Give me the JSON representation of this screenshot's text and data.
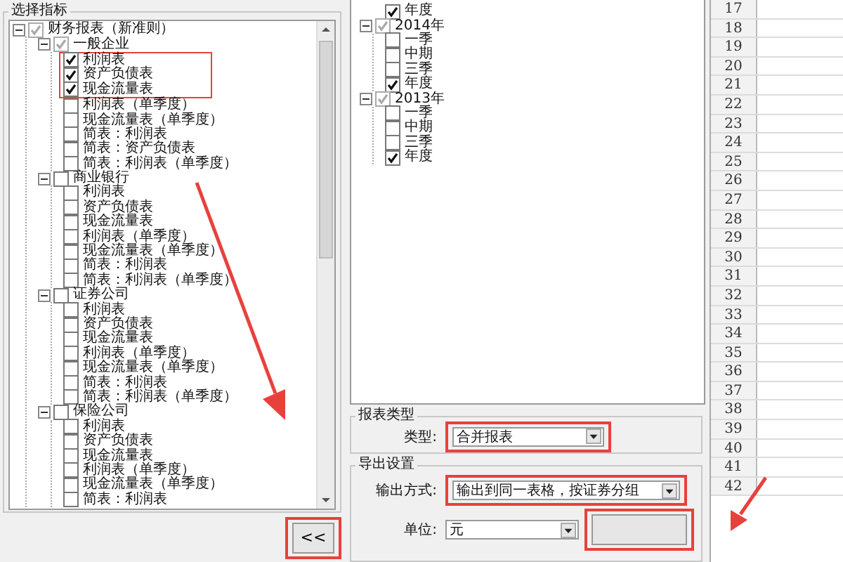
{
  "indicator_panel": {
    "title": "选择指标",
    "tree": [
      {
        "label": "财务报表（新准则）",
        "checked": true,
        "partial": true,
        "expanded": true,
        "children": [
          {
            "label": "一般企业",
            "checked": true,
            "partial": true,
            "expanded": true,
            "children": [
              {
                "label": "利润表",
                "checked": true,
                "highlighted": true
              },
              {
                "label": "资产负债表",
                "checked": true,
                "highlighted": true
              },
              {
                "label": "现金流量表",
                "checked": true,
                "highlighted": true
              },
              {
                "label": "利润表（单季度）",
                "checked": false,
                "highlighted": false
              },
              {
                "label": "现金流量表（单季度）",
                "checked": false,
                "highlighted": false
              },
              {
                "label": "简表：利润表",
                "checked": false,
                "highlighted": false
              },
              {
                "label": "简表：资产负债表",
                "checked": false,
                "highlighted": false
              },
              {
                "label": "简表：利润表（单季度）",
                "checked": false,
                "highlighted": false
              }
            ]
          },
          {
            "label": "商业银行",
            "checked": false,
            "partial": false,
            "expanded": true,
            "children": [
              {
                "label": "利润表",
                "checked": false
              },
              {
                "label": "资产负债表",
                "checked": false
              },
              {
                "label": "现金流量表",
                "checked": false
              },
              {
                "label": "利润表（单季度）",
                "checked": false
              },
              {
                "label": "现金流量表（单季度）",
                "checked": false
              },
              {
                "label": "简表：利润表",
                "checked": false
              },
              {
                "label": "简表：利润表（单季度）",
                "checked": false
              }
            ]
          },
          {
            "label": "证券公司",
            "checked": false,
            "partial": false,
            "expanded": true,
            "children": [
              {
                "label": "利润表",
                "checked": false
              },
              {
                "label": "资产负债表",
                "checked": false
              },
              {
                "label": "现金流量表",
                "checked": false
              },
              {
                "label": "利润表（单季度）",
                "checked": false
              },
              {
                "label": "现金流量表（单季度）",
                "checked": false
              },
              {
                "label": "简表：利润表",
                "checked": false
              },
              {
                "label": "简表：利润表（单季度）",
                "checked": false
              }
            ]
          },
          {
            "label": "保险公司",
            "checked": false,
            "partial": false,
            "expanded": true,
            "children": [
              {
                "label": "利润表",
                "checked": false
              },
              {
                "label": "资产负债表",
                "checked": false
              },
              {
                "label": "现金流量表",
                "checked": false
              },
              {
                "label": "利润表（单季度）",
                "checked": false
              },
              {
                "label": "现金流量表（单季度）",
                "checked": false
              },
              {
                "label": "简表：利润表",
                "checked": false
              }
            ]
          }
        ]
      }
    ]
  },
  "collapse_button": {
    "label": "<<"
  },
  "period_tree": {
    "leading_items": [
      {
        "label": "年度",
        "checked": true
      }
    ],
    "years": [
      {
        "label": "2014年",
        "checked": true,
        "partial": true,
        "expanded": true,
        "children": [
          {
            "label": "一季",
            "checked": false
          },
          {
            "label": "中期",
            "checked": false
          },
          {
            "label": "三季",
            "checked": false
          },
          {
            "label": "年度",
            "checked": true
          }
        ]
      },
      {
        "label": "2013年",
        "checked": true,
        "partial": true,
        "expanded": true,
        "children": [
          {
            "label": "一季",
            "checked": false
          },
          {
            "label": "中期",
            "checked": false
          },
          {
            "label": "三季",
            "checked": false
          },
          {
            "label": "年度",
            "checked": true
          }
        ]
      }
    ]
  },
  "report_type": {
    "title": "报表类型",
    "label": "类型:",
    "value": "合并报表"
  },
  "export_settings": {
    "title": "导出设置",
    "output_label": "输出方式:",
    "output_value": "输出到同一表格，按证券分组",
    "unit_label": "单位:",
    "unit_value": "元"
  },
  "spreadsheet": {
    "row_numbers": [
      "17",
      "18",
      "19",
      "20",
      "21",
      "22",
      "23",
      "24",
      "25",
      "26",
      "27",
      "28",
      "29",
      "30",
      "31",
      "32",
      "33",
      "34",
      "35",
      "36",
      "37",
      "38",
      "39",
      "40",
      "41",
      "42"
    ]
  }
}
